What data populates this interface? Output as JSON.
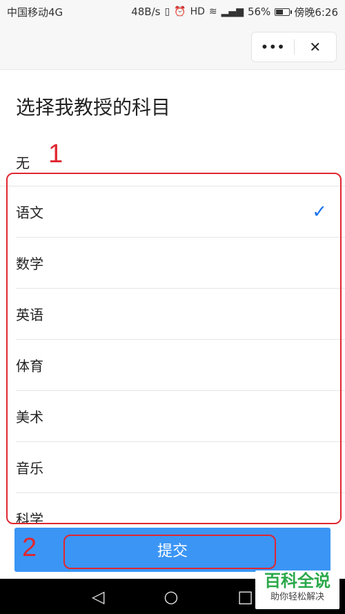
{
  "status_bar": {
    "carrier": "中国移动4G",
    "speed": "48B/s",
    "battery_percent": "56%",
    "battery_level": 0.56,
    "time": "傍晚6:26",
    "icons": [
      "vibrate-icon",
      "alarm-icon",
      "hd-icon",
      "wifi-icon",
      "signal-icon",
      "battery-icon"
    ]
  },
  "nav": {
    "more_icon": "•••",
    "close_icon": "✕"
  },
  "page": {
    "title": "选择我教授的科目",
    "none_option": "无"
  },
  "options": [
    {
      "label": "语文",
      "selected": true
    },
    {
      "label": "数学",
      "selected": false
    },
    {
      "label": "英语",
      "selected": false
    },
    {
      "label": "体育",
      "selected": false
    },
    {
      "label": "美术",
      "selected": false
    },
    {
      "label": "音乐",
      "selected": false
    },
    {
      "label": "科学",
      "selected": false
    }
  ],
  "check_glyph": "✓",
  "submit_label": "提交",
  "annotations": {
    "one": "1",
    "two": "2",
    "color": "#e0262f"
  },
  "android_nav": {
    "back": "◁",
    "home": "○",
    "recent": "□"
  },
  "watermark": {
    "title": "百科全说",
    "subtitle": "助你轻松解决"
  },
  "colors": {
    "accent": "#3b95f5",
    "check": "#1a73e8",
    "watermark_green": "#2aa84a"
  }
}
